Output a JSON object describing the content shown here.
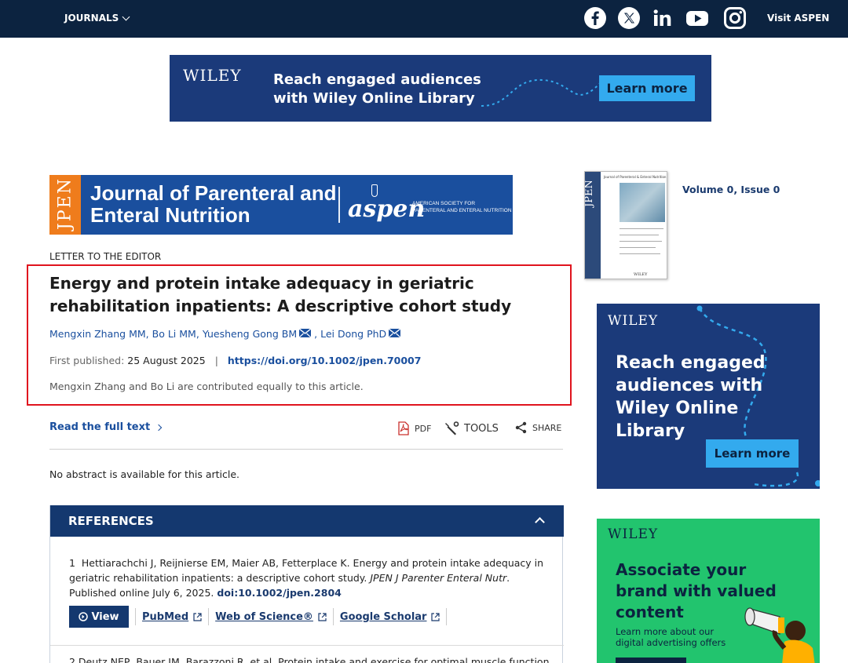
{
  "topbar": {
    "journals_label": "JOURNALS",
    "visit_label": "Visit ASPEN",
    "social_icons": [
      "facebook-icon",
      "x-icon",
      "linkedin-icon",
      "youtube-icon",
      "instagram-icon"
    ]
  },
  "banner_top": {
    "brand": "WILEY",
    "headline_line1": "Reach engaged audiences",
    "headline_line2": "with Wiley Online Library",
    "button": "Learn more"
  },
  "journal_banner": {
    "abbrev": "JPEN",
    "title_line1": "Journal of Parenteral and",
    "title_line2": "Enteral Nutrition",
    "society_mark": "aspen",
    "society_line1": "AMERICAN SOCIETY FOR",
    "society_line2": "PARENTERAL AND ENTERAL NUTRITION"
  },
  "article": {
    "type": "LETTER TO THE EDITOR",
    "title": "Energy and protein intake adequacy in geriatric rehabilitation inpatients: A descriptive cohort study",
    "authors": [
      {
        "name": "Mengxin Zhang MM",
        "mail": false
      },
      {
        "name": "Bo Li MM",
        "mail": false
      },
      {
        "name": "Yuesheng Gong BM",
        "mail": true
      },
      {
        "name": "Lei Dong PhD",
        "mail": true
      }
    ],
    "first_published_label": "First published:",
    "first_published_date": "25 August 2025",
    "doi": "https://doi.org/10.1002/jpen.70007",
    "note": "Mengxin Zhang and Bo Li are contributed equally to this article.",
    "read_full_text": "Read the full text",
    "tools": {
      "pdf": "PDF",
      "tools": "TOOLS",
      "share": "SHARE"
    },
    "no_abstract": "No abstract is available for this article."
  },
  "references": {
    "heading": "REFERENCES",
    "items": [
      {
        "number": "1",
        "text_before": "Hettiarachchi J, Reijnierse EM, Maier AB, Fetterplace K. Energy and protein intake adequacy in geriatric rehabilitation inpatients: a descriptive cohort study. ",
        "journal": "JPEN J Parenter Enteral Nutr",
        "text_after": ". Published online July 6, 2025. ",
        "doi": "doi:10.1002/jpen.2804",
        "view": "View",
        "links": [
          "PubMed",
          "Web of Science®",
          "Google Scholar"
        ]
      }
    ],
    "next_item_partial": "2   Deutz NEP, Bauer JM, Barazzoni R, et al. Protein intake and exercise for optimal muscle function"
  },
  "sidebar": {
    "cover_abbrev": "JPEN",
    "cover_title": "Journal of Parenteral & Enteral Nutrition",
    "cover_brand": "WILEY",
    "volume": "Volume 0, Issue 0",
    "ad_wiley": {
      "brand": "WILEY",
      "headline": "Reach engaged audiences with Wiley Online Library",
      "button": "Learn more"
    },
    "ad_brand": {
      "brand": "WILEY",
      "headline": "Associate your brand with valued content",
      "sub": "Learn more about our digital advertising offers"
    }
  },
  "colors": {
    "topbar": "#0c2340",
    "wiley_blue": "#1b3a7a",
    "learn_more": "#33aaee",
    "jpen_orange": "#ef7c1c",
    "link_blue": "#1a4f9e",
    "highlight_red": "#e0141e",
    "ad_green": "#22c46e"
  }
}
